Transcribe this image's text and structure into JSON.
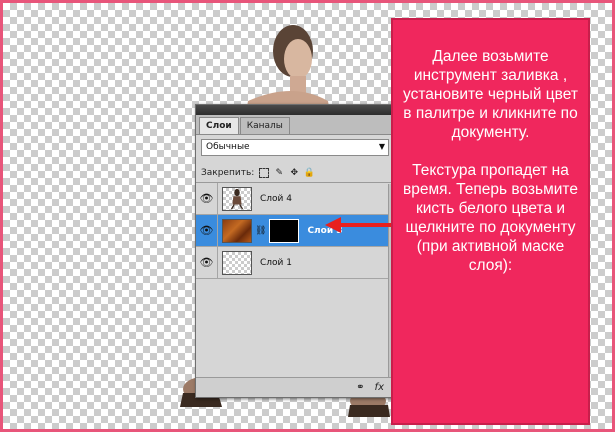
{
  "panel": {
    "tabs": [
      {
        "label": "Слои",
        "active": true
      },
      {
        "label": "Каналы",
        "active": false
      }
    ],
    "blend_mode": "Обычные",
    "lock_label": "Закрепить:",
    "layers": [
      {
        "name": "Слой 4",
        "thumb": "figure",
        "selected": false
      },
      {
        "name": "Слой 3",
        "thumb": "texture-mask",
        "selected": true
      },
      {
        "name": "Слой 1",
        "thumb": "transparent",
        "selected": false
      }
    ],
    "footer_icons": [
      "link-icon",
      "fx-icon"
    ]
  },
  "instructions": {
    "paragraph_1": "Далее возьмите инструмент заливка , установите черный цвет в палитре и кликните по документу.",
    "paragraph_2": "Текстура пропадет на время. Теперь возьмите кисть белого цвета и щелкните по документу (при активной маске слоя):"
  },
  "colors": {
    "frame_border": "#e8557a",
    "info_box": "#f0275d",
    "selected_layer": "#3a8cde",
    "arrow": "#e8201e"
  }
}
